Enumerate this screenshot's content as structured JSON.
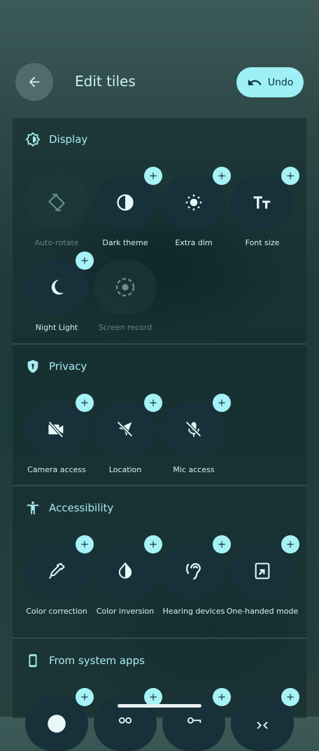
{
  "header": {
    "title": "Edit tiles",
    "undo_label": "Undo"
  },
  "sections": {
    "display": {
      "title": "Display",
      "tiles": [
        {
          "label": "Auto-rotate",
          "icon": "auto-rotate-icon",
          "enabled": false
        },
        {
          "label": "Dark theme",
          "icon": "dark-theme-icon",
          "enabled": true
        },
        {
          "label": "Extra dim",
          "icon": "extra-dim-icon",
          "enabled": true
        },
        {
          "label": "Font size",
          "icon": "font-size-icon",
          "enabled": true
        },
        {
          "label": "Night Light",
          "icon": "night-light-icon",
          "enabled": true
        },
        {
          "label": "Screen record",
          "icon": "screen-record-icon",
          "enabled": false
        }
      ]
    },
    "privacy": {
      "title": "Privacy",
      "tiles": [
        {
          "label": "Camera access",
          "icon": "camera-off-icon"
        },
        {
          "label": "Location",
          "icon": "location-off-icon"
        },
        {
          "label": "Mic access",
          "icon": "mic-off-icon"
        }
      ]
    },
    "accessibility": {
      "title": "Accessibility",
      "tiles": [
        {
          "label": "Color correction",
          "icon": "eyedropper-icon"
        },
        {
          "label": "Color inversion",
          "icon": "color-inversion-icon"
        },
        {
          "label": "Hearing devices",
          "icon": "hearing-icon"
        },
        {
          "label": "One-handed mode",
          "icon": "one-handed-icon"
        }
      ]
    },
    "system_apps": {
      "title": "From system apps"
    }
  },
  "colors": {
    "accent": "#a6f2f7",
    "tile_bg": "#17303a",
    "dim_label": "#5f8487"
  }
}
